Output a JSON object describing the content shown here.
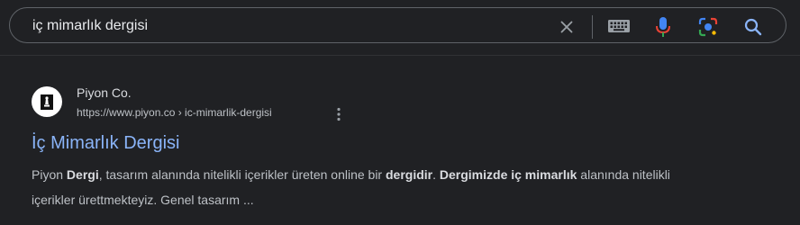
{
  "search": {
    "query": "iç mimarlık dergisi"
  },
  "icons": {
    "clear": "close-icon",
    "keyboard": "keyboard-icon",
    "voice": "mic-icon",
    "image_search": "lens-icon",
    "search": "search-icon",
    "more": "more-vert-icon"
  },
  "result": {
    "site_name": "Piyon Co.",
    "url_base": "https://www.piyon.co",
    "url_path": " › ic-mimarlik-dergisi",
    "title": "İç Mimarlık Dergisi",
    "snippet": [
      {
        "text": "Piyon ",
        "bold": false
      },
      {
        "text": "Dergi",
        "bold": true
      },
      {
        "text": ", tasarım alanında nitelikli içerikler üreten online bir ",
        "bold": false
      },
      {
        "text": "dergidir",
        "bold": true
      },
      {
        "text": ". ",
        "bold": false
      },
      {
        "text": "Dergimizde iç mimarlık",
        "bold": true
      },
      {
        "text": " alanında nitelikli içerikler ürettmekteyiz. Genel tasarım ...",
        "bold": false
      }
    ]
  },
  "colors": {
    "background": "#202124",
    "title_link": "#8ab4f8",
    "text": "#bdc1c6",
    "border": "#5f6368"
  }
}
